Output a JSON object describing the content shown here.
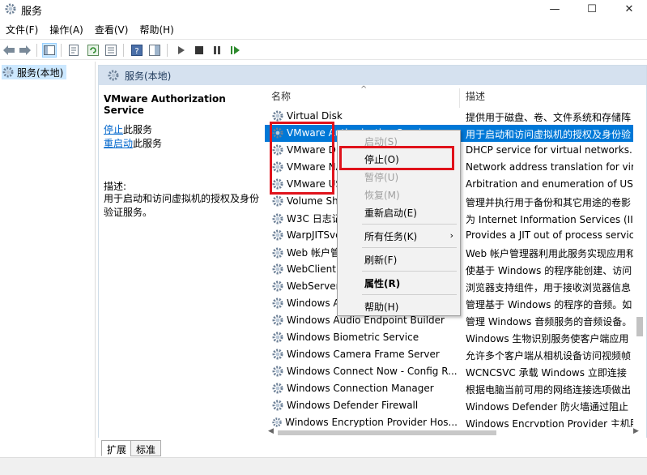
{
  "window": {
    "title": "服务",
    "min": "—",
    "max": "☐",
    "close": "✕"
  },
  "menubar": [
    "文件(F)",
    "操作(A)",
    "查看(V)",
    "帮助(H)"
  ],
  "tree": {
    "root": "服务(本地)"
  },
  "panel": {
    "header": "服务(本地)",
    "service_name": "VMware Authorization Service",
    "stop_link": "停止",
    "stop_suffix": "此服务",
    "restart_link": "重启动",
    "restart_suffix": "此服务",
    "desc_label": "描述:",
    "desc_text": "用于启动和访问虚拟机的授权及身份验证服务。"
  },
  "columns": {
    "name": "名称",
    "desc": "描述",
    "sort": "^"
  },
  "rows": [
    {
      "name": "Virtual Disk",
      "desc": "提供用于磁盘、卷、文件系统和存储阵"
    },
    {
      "name": "VMware Authorization Service",
      "desc": "用于启动和访问虚拟机的授权及身份验"
    },
    {
      "name": "VMware DHCP Service",
      "desc": "DHCP service for virtual networks."
    },
    {
      "name": "VMware NAT Service",
      "desc": "Network address translation for vir"
    },
    {
      "name": "VMware USB Arbitration Service",
      "desc": "Arbitration and enumeration of USB"
    },
    {
      "name": "Volume Shadow Copy",
      "desc": "管理并执行用于备份和其它用途的卷影"
    },
    {
      "name": "W3C 日志记录服务",
      "desc": "为 Internet Information Services (IIS"
    },
    {
      "name": "WarpJITSvc",
      "desc": "Provides a JIT out of process servic"
    },
    {
      "name": "Web 帐户管理器",
      "desc": "Web 帐户管理器利用此服务实现应用和"
    },
    {
      "name": "WebClient",
      "desc": "使基于 Windows 的程序能创建、访问"
    },
    {
      "name": "WebServer",
      "desc": "浏览器支持组件，用于接收浏览器信息"
    },
    {
      "name": "Windows Audio",
      "desc": "管理基于 Windows 的程序的音频。如"
    },
    {
      "name": "Windows Audio Endpoint Builder",
      "desc": "管理 Windows 音频服务的音频设备。"
    },
    {
      "name": "Windows Biometric Service",
      "desc": "Windows 生物识别服务使客户端应用"
    },
    {
      "name": "Windows Camera Frame Server",
      "desc": "允许多个客户端从相机设备访问视频帧"
    },
    {
      "name": "Windows Connect Now - Config R...",
      "desc": "WCNCSVC 承载 Windows 立即连接"
    },
    {
      "name": "Windows Connection Manager",
      "desc": "根据电脑当前可用的网络连接选项做出"
    },
    {
      "name": "Windows Defender Firewall",
      "desc": "Windows Defender 防火墙通过阻止"
    },
    {
      "name": "Windows Encryption Provider Hos...",
      "desc": "Windows Encryption Provider 主机服"
    }
  ],
  "context_menu": {
    "start": "启动(S)",
    "stop": "停止(O)",
    "pause": "暂停(U)",
    "resume": "恢复(M)",
    "restart": "重新启动(E)",
    "all_tasks": "所有任务(K)",
    "refresh": "刷新(F)",
    "properties": "属性(R)",
    "help": "帮助(H)",
    "submenu_arrow": "›"
  },
  "tabs": [
    "扩展",
    "标准"
  ],
  "colors": {
    "selection": "#0078d7",
    "highlight": "#e0121b",
    "header": "#d5e1ef"
  }
}
